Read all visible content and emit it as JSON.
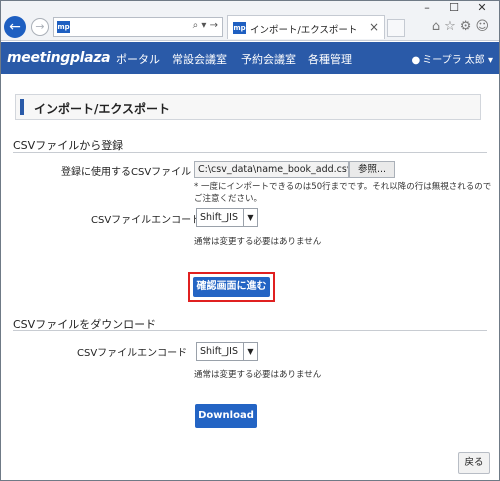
{
  "browser": {
    "url_favicon": "mp",
    "tab_title": "インポート/エクスポート",
    "address_tools": "⌕ ▾ →"
  },
  "navbar": {
    "logo": "meetingplaza",
    "items": [
      "ポータル",
      "常設会議室",
      "予約会議室",
      "各種管理"
    ],
    "user_name": "ミープラ  太郎 ▾"
  },
  "page": {
    "title": "インポート/エクスポート"
  },
  "import_section": {
    "title": "CSVファイルから登録",
    "file_label": "登録に使用するCSVファイル",
    "file_value": "C:\\csv_data\\name_book_add.csv",
    "browse_label": "参照...",
    "note": "* 一度にインポートできるのは50行までです。それ以降の行は無視されるのでご注意ください。",
    "encode_label": "CSVファイルエンコード",
    "encode_value": "Shift_JIS",
    "encode_hint": "通常は変更する必要はありません",
    "confirm_button": "確認画面に進む"
  },
  "download_section": {
    "title": "CSVファイルをダウンロード",
    "encode_label": "CSVファイルエンコード",
    "encode_value": "Shift_JIS",
    "encode_hint": "通常は変更する必要はありません",
    "download_button": "Download"
  },
  "footer": {
    "back_button": "戻る"
  },
  "colors": {
    "navbar": "#2a5aa8",
    "primary_button": "#2364c4",
    "highlight": "#e02020"
  }
}
